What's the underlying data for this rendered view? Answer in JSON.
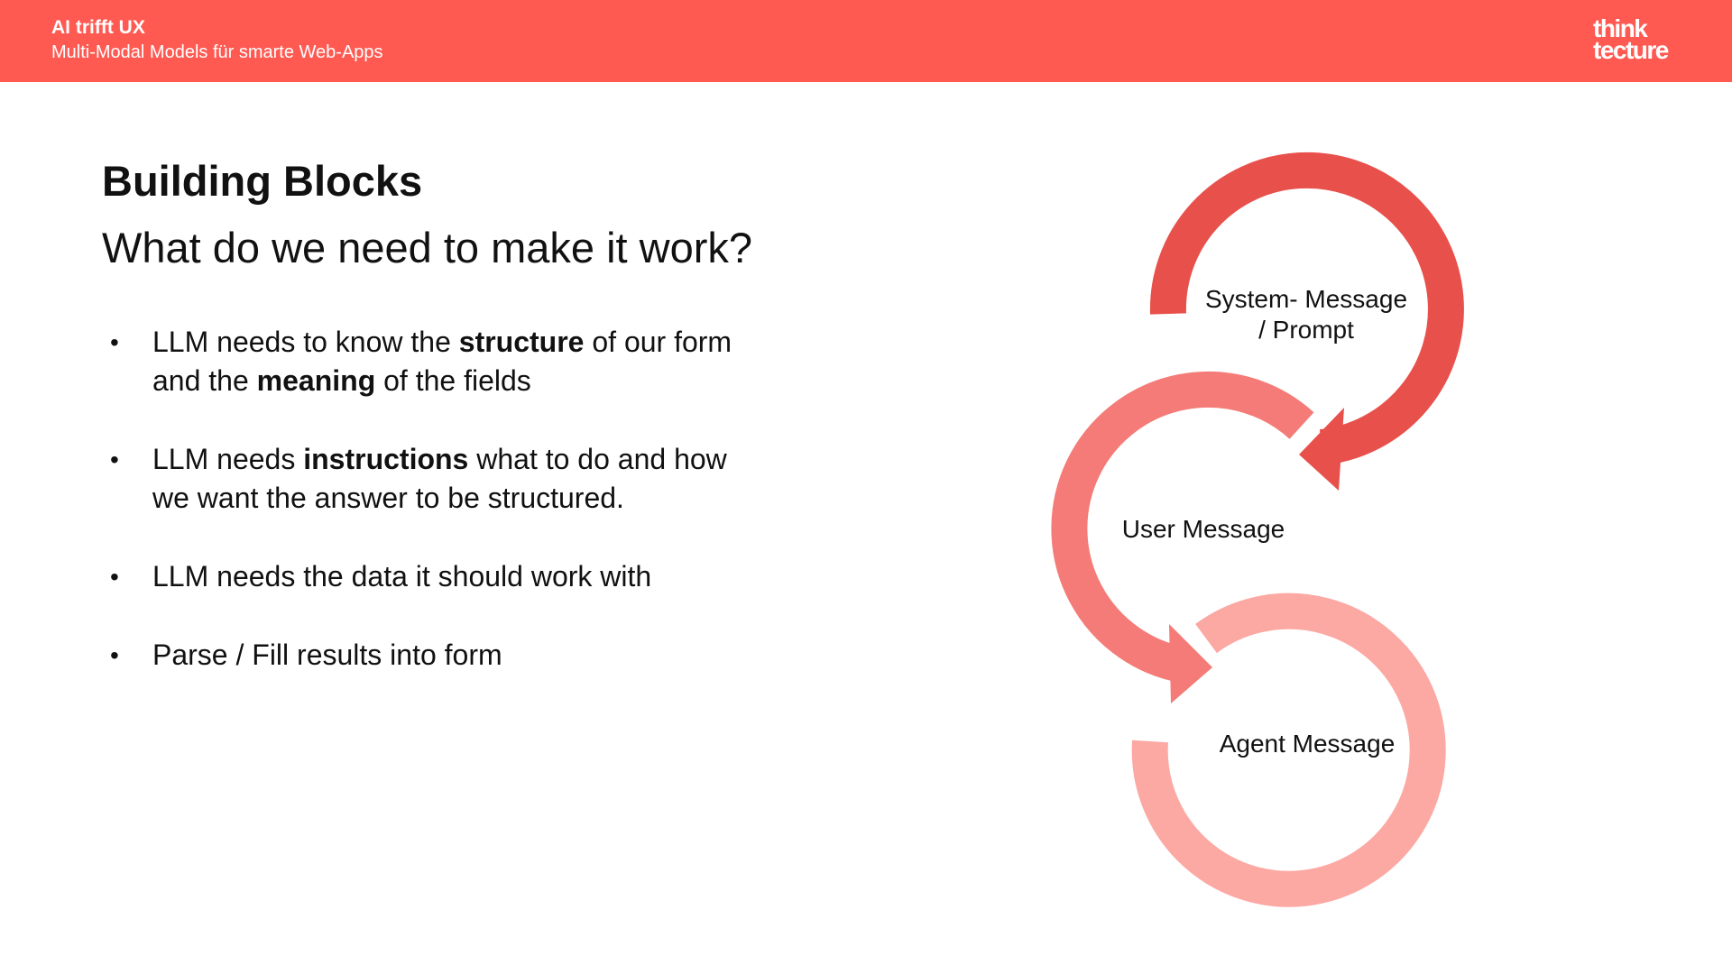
{
  "header": {
    "title": "AI trifft UX",
    "subtitle": "Multi-Modal Models für smarte Web-Apps",
    "logo_line1": "think",
    "logo_line2": "tecture",
    "background_color": "#ff5a52"
  },
  "slide": {
    "title": "Building Blocks",
    "subtitle": "What do we need to make it work?"
  },
  "bullets": [
    {
      "pre": "LLM needs to know the ",
      "bold1": "structure",
      "mid": " of our form and the ",
      "bold2": "meaning",
      "post": " of the fields"
    },
    {
      "pre": "LLM needs ",
      "bold1": "instructions",
      "post": " what to do and how we want the answer to be structured."
    },
    {
      "text": "LLM needs the data it should work with"
    },
    {
      "text": "Parse / Fill results into form"
    }
  ],
  "bullet_symbol": "•",
  "diagram": {
    "system_line1": "System- Message",
    "system_line2": "/ Prompt",
    "user": "User Message",
    "agent": "Agent Message",
    "colors": {
      "system": "#e8504b",
      "user": "#f47b77",
      "agent": "#fca8a3"
    }
  }
}
